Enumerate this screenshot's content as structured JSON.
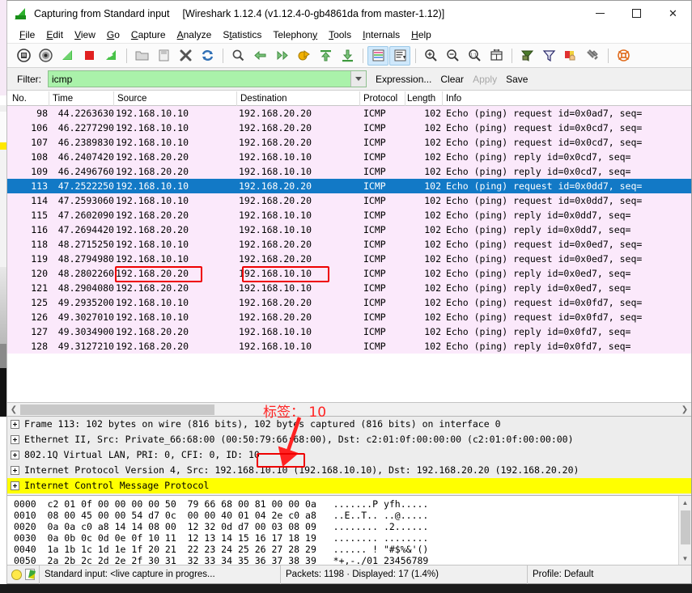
{
  "window": {
    "title": "Capturing from Standard input",
    "subtitle": "[Wireshark 1.12.4  (v1.12.4-0-gb4861da from master-1.12)]",
    "minimize_label": "–",
    "maximize_label": "□",
    "close_label": "✕"
  },
  "menu": [
    {
      "label": "File"
    },
    {
      "label": "Edit"
    },
    {
      "label": "View"
    },
    {
      "label": "Go"
    },
    {
      "label": "Capture"
    },
    {
      "label": "Analyze"
    },
    {
      "label": "Statistics"
    },
    {
      "label": "Telephony"
    },
    {
      "label": "Tools"
    },
    {
      "label": "Internals"
    },
    {
      "label": "Help"
    }
  ],
  "toolbar": [
    {
      "name": "interfaces-icon"
    },
    {
      "name": "capture-options-icon"
    },
    {
      "name": "start-capture-icon"
    },
    {
      "name": "stop-capture-icon"
    },
    {
      "name": "restart-capture-icon"
    },
    {
      "name": "separator"
    },
    {
      "name": "open-file-icon"
    },
    {
      "name": "save-file-icon"
    },
    {
      "name": "close-file-icon"
    },
    {
      "name": "reload-file-icon"
    },
    {
      "name": "separator"
    },
    {
      "name": "find-packet-icon"
    },
    {
      "name": "go-back-icon"
    },
    {
      "name": "go-forward-icon"
    },
    {
      "name": "go-to-packet-icon"
    },
    {
      "name": "go-first-packet-icon"
    },
    {
      "name": "go-last-packet-icon"
    },
    {
      "name": "separator"
    },
    {
      "name": "colorize-packet-list-icon"
    },
    {
      "name": "auto-scroll-live-capture-icon"
    },
    {
      "name": "separator"
    },
    {
      "name": "zoom-in-icon"
    },
    {
      "name": "zoom-out-icon"
    },
    {
      "name": "zoom-normal-icon"
    },
    {
      "name": "resize-columns-icon"
    },
    {
      "name": "separator"
    },
    {
      "name": "capture-filters-icon"
    },
    {
      "name": "display-filters-icon"
    },
    {
      "name": "coloring-rules-icon"
    },
    {
      "name": "preferences-icon"
    },
    {
      "name": "separator"
    },
    {
      "name": "help-contents-icon"
    }
  ],
  "filter": {
    "label": "Filter:",
    "value": "icmp",
    "placeholder": "",
    "expression_label": "Expression...",
    "clear_label": "Clear",
    "apply_label": "Apply",
    "save_label": "Save",
    "bg_color": "#aaf2aa"
  },
  "packet_list": {
    "columns": [
      {
        "label": "No."
      },
      {
        "label": "Time"
      },
      {
        "label": "Source"
      },
      {
        "label": "Destination"
      },
      {
        "label": "Protocol"
      },
      {
        "label": "Length"
      },
      {
        "label": "Info"
      }
    ],
    "selected_index": 5,
    "row_bg_color": "#fbe9fb",
    "selected_bg_color": "#1279c6",
    "rows": [
      {
        "no": "98",
        "time": "44.2263630",
        "src": "192.168.10.10",
        "dst": "192.168.20.20",
        "proto": "ICMP",
        "len": "102",
        "info": "Echo (ping) request   id=0x0ad7, seq="
      },
      {
        "no": "106",
        "time": "46.2277290",
        "src": "192.168.10.10",
        "dst": "192.168.20.20",
        "proto": "ICMP",
        "len": "102",
        "info": "Echo (ping) request   id=0x0cd7, seq="
      },
      {
        "no": "107",
        "time": "46.2389830",
        "src": "192.168.10.10",
        "dst": "192.168.20.20",
        "proto": "ICMP",
        "len": "102",
        "info": "Echo (ping) request   id=0x0cd7, seq="
      },
      {
        "no": "108",
        "time": "46.2407420",
        "src": "192.168.20.20",
        "dst": "192.168.10.10",
        "proto": "ICMP",
        "len": "102",
        "info": "Echo (ping) reply     id=0x0cd7, seq="
      },
      {
        "no": "109",
        "time": "46.2496760",
        "src": "192.168.20.20",
        "dst": "192.168.10.10",
        "proto": "ICMP",
        "len": "102",
        "info": "Echo (ping) reply     id=0x0cd7, seq="
      },
      {
        "no": "113",
        "time": "47.2522250",
        "src": "192.168.10.10",
        "dst": "192.168.20.20",
        "proto": "ICMP",
        "len": "102",
        "info": "Echo (ping) request   id=0x0dd7, seq="
      },
      {
        "no": "114",
        "time": "47.2593060",
        "src": "192.168.10.10",
        "dst": "192.168.20.20",
        "proto": "ICMP",
        "len": "102",
        "info": "Echo (ping) request   id=0x0dd7, seq="
      },
      {
        "no": "115",
        "time": "47.2602090",
        "src": "192.168.20.20",
        "dst": "192.168.10.10",
        "proto": "ICMP",
        "len": "102",
        "info": "Echo (ping) reply     id=0x0dd7, seq="
      },
      {
        "no": "116",
        "time": "47.2694420",
        "src": "192.168.20.20",
        "dst": "192.168.10.10",
        "proto": "ICMP",
        "len": "102",
        "info": "Echo (ping) reply     id=0x0dd7, seq="
      },
      {
        "no": "118",
        "time": "48.2715250",
        "src": "192.168.10.10",
        "dst": "192.168.20.20",
        "proto": "ICMP",
        "len": "102",
        "info": "Echo (ping) request   id=0x0ed7, seq="
      },
      {
        "no": "119",
        "time": "48.2794980",
        "src": "192.168.10.10",
        "dst": "192.168.20.20",
        "proto": "ICMP",
        "len": "102",
        "info": "Echo (ping) request   id=0x0ed7, seq="
      },
      {
        "no": "120",
        "time": "48.2802260",
        "src": "192.168.20.20",
        "dst": "192.168.10.10",
        "proto": "ICMP",
        "len": "102",
        "info": "Echo (ping) reply     id=0x0ed7, seq="
      },
      {
        "no": "121",
        "time": "48.2904080",
        "src": "192.168.20.20",
        "dst": "192.168.10.10",
        "proto": "ICMP",
        "len": "102",
        "info": "Echo (ping) reply     id=0x0ed7, seq="
      },
      {
        "no": "125",
        "time": "49.2935200",
        "src": "192.168.10.10",
        "dst": "192.168.20.20",
        "proto": "ICMP",
        "len": "102",
        "info": "Echo (ping) request   id=0x0fd7, seq="
      },
      {
        "no": "126",
        "time": "49.3027010",
        "src": "192.168.10.10",
        "dst": "192.168.20.20",
        "proto": "ICMP",
        "len": "102",
        "info": "Echo (ping) request   id=0x0fd7, seq="
      },
      {
        "no": "127",
        "time": "49.3034900",
        "src": "192.168.20.20",
        "dst": "192.168.10.10",
        "proto": "ICMP",
        "len": "102",
        "info": "Echo (ping) reply     id=0x0fd7, seq="
      },
      {
        "no": "128",
        "time": "49.3127210",
        "src": "192.168.20.20",
        "dst": "192.168.10.10",
        "proto": "ICMP",
        "len": "102",
        "info": "Echo (ping) reply     id=0x0fd7, seq="
      }
    ]
  },
  "packet_details": {
    "rows": [
      {
        "text": "Frame 113: 102 bytes on wire (816 bits), 102 bytes captured (816 bits) on interface 0",
        "highlight": false
      },
      {
        "text": "Ethernet II, Src: Private_66:68:00 (00:50:79:66:68:00), Dst: c2:01:0f:00:00:00 (c2:01:0f:00:00:00)",
        "highlight": false
      },
      {
        "text": "802.1Q Virtual LAN, PRI: 0, CFI: 0, ID: 10",
        "highlight": false
      },
      {
        "text": "Internet Protocol Version 4, Src: 192.168.10.10 (192.168.10.10), Dst: 192.168.20.20 (192.168.20.20)",
        "highlight": false
      },
      {
        "text": "Internet Control Message Protocol",
        "highlight": true
      }
    ],
    "highlight_color": "#ffff00"
  },
  "packet_bytes": {
    "rows": [
      {
        "offset": "0000",
        "hex1": "c2 01 0f 00 00 00 00 50",
        "hex2": "79 66 68 00 81 00 00 0a",
        "ascii1": ".......P",
        "ascii2": " yfh....."
      },
      {
        "offset": "0010",
        "hex1": "08 00 45 00 00 54 d7 0c",
        "hex2": "00 00 40 01 04 2e c0 a8",
        "ascii1": "..E..T..",
        "ascii2": " ..@....."
      },
      {
        "offset": "0020",
        "hex1": "0a 0a c0 a8 14 14 08 00",
        "hex2": "12 32 0d d7 00 03 08 09",
        "ascii1": "........",
        "ascii2": " .2......"
      },
      {
        "offset": "0030",
        "hex1": "0a 0b 0c 0d 0e 0f 10 11",
        "hex2": "12 13 14 15 16 17 18 19",
        "ascii1": "........",
        "ascii2": " ........"
      },
      {
        "offset": "0040",
        "hex1": "1a 1b 1c 1d 1e 1f 20 21",
        "hex2": "22 23 24 25 26 27 28 29",
        "ascii1": "...... !",
        "ascii2": " \"#$%&'()"
      },
      {
        "offset": "0050",
        "hex1": "2a 2b 2c 2d 2e 2f 30 31",
        "hex2": "32 33 34 35 36 37 38 39",
        "ascii1": "*+,-./01",
        "ascii2": " 23456789"
      }
    ]
  },
  "status_bar": {
    "capture_source": "Standard input: <live capture in progres...",
    "packets_text": "Packets: 1198 · Displayed: 17 (1.4%)",
    "profile_text": "Profile: Default"
  },
  "annotation": {
    "text": "标签： 10",
    "color": "#ff2222",
    "highlight_boxes": [
      {
        "name": "source-ip-highlight"
      },
      {
        "name": "destination-ip-highlight"
      },
      {
        "name": "vlan-id-highlight"
      }
    ]
  }
}
